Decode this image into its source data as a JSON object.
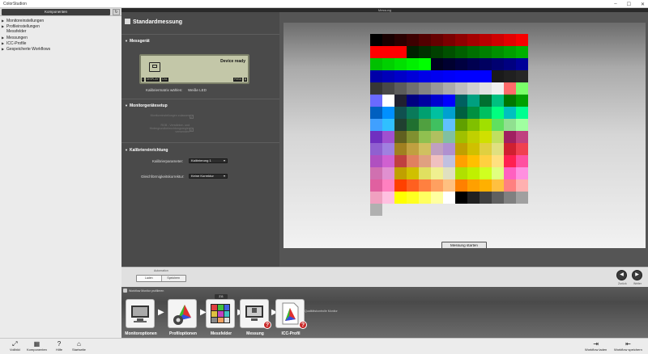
{
  "window": {
    "app_title": "ColorStudion",
    "controls": [
      "–",
      "☐",
      "✕"
    ]
  },
  "sidebar": {
    "tab_label": "Komponenten",
    "refresh_icon": "↻",
    "items": [
      {
        "label": "Monitoreinstellungen",
        "arrow": true
      },
      {
        "label": "Profileinstellungen",
        "arrow": true
      },
      {
        "label": "Messfelder",
        "arrow": false
      },
      {
        "label": "Messungen",
        "arrow": true
      },
      {
        "label": "ICC-Profile",
        "arrow": true
      },
      {
        "label": "Gespeicherte Workflows",
        "arrow": true
      }
    ]
  },
  "panel": {
    "window_title": "Messung",
    "title": "Standardmessung",
    "sections": {
      "device": "Messgerät",
      "monitor": "Monitorgerätesetup",
      "calibration": "Kalibriereinrichtung"
    },
    "lcd": {
      "status": "Device ready",
      "buttons": [
        "i",
        "DISPLAY",
        "CAL",
        "",
        "RIGA",
        "▮"
      ]
    },
    "matrix_label": "Kalibriermatrix wählen:",
    "matrix_value": "Weiße LED",
    "monitor_opts": [
      {
        "label": "Monitoreinstellungen zulassen",
        "checked": "✓"
      },
      {
        "label": "RGB - Verstärker- und Hintergrundbeleuchtungsregler verwenden",
        "checked": "✓"
      }
    ],
    "cal_param_label": "Kalibrierparameter:",
    "cal_param_value": "Kalibrierung 1",
    "uniformity_label": "Gleichförmigkeitskorrektur:",
    "uniformity_value": "Keine Korrektur"
  },
  "measure": {
    "start_label": "Messung starten",
    "patches": [
      [
        "#000000",
        "#180000",
        "#2a0000",
        "#3d0000",
        "#520000",
        "#660000",
        "#7b0000",
        "#900000",
        "#a50000",
        "#ba0000",
        "#cf0000",
        "#e40000",
        "#f80000"
      ],
      [
        "#ff0000",
        "#ff0000",
        "#ff0000",
        "#002000",
        "#003000",
        "#004000",
        "#005000",
        "#006000",
        "#007000",
        "#008000",
        "#009000",
        "#00a000",
        "#00b000"
      ],
      [
        "#00c000",
        "#00d000",
        "#00e000",
        "#00f000",
        "#00ff00",
        "#000020",
        "#000030",
        "#000040",
        "#000050",
        "#000060",
        "#000070",
        "#000080",
        "#000098"
      ],
      [
        "#0000a8",
        "#0000b8",
        "#0000c8",
        "#0000d8",
        "#0000e8",
        "#0000f0",
        "#0000f8",
        "#0000ff",
        "#0000ff",
        "#0000ff",
        "#1a1a1a",
        "#202020",
        "#262626"
      ],
      [
        "#363636",
        "#484848",
        "#5c5c5c",
        "#707070",
        "#848484",
        "#989898",
        "#ababab",
        "#bebebe",
        "#d0d0d0",
        "#e2e2e2",
        "#f0f0f0",
        "#ff6a6a",
        "#7aff6a"
      ],
      [
        "#6a6aff",
        "#ffffff",
        "#202030",
        "#000080",
        "#0000a0",
        "#0000d0",
        "#0000ff",
        "#006060",
        "#00a080",
        "#007030",
        "#00c080",
        "#007700",
        "#00a000"
      ],
      [
        "#0060c0",
        "#0090ff",
        "#105050",
        "#0a7a5a",
        "#00a070",
        "#00c0a0",
        "#00a0d0",
        "#006040",
        "#009040",
        "#00c060",
        "#00ff80",
        "#00c0c0",
        "#00ff90"
      ],
      [
        "#40a0ff",
        "#30c0ff",
        "#204030",
        "#207030",
        "#50a040",
        "#40c060",
        "#60c0ff",
        "#60a000",
        "#80c000",
        "#a0e000",
        "#60e060",
        "#90e090",
        "#a0ffa0"
      ],
      [
        "#7030c0",
        "#a050d0",
        "#606020",
        "#809030",
        "#90c050",
        "#b0c060",
        "#80c0a0",
        "#a0c000",
        "#c0d000",
        "#d0e000",
        "#c0e060",
        "#a02060",
        "#c04080"
      ],
      [
        "#9060d0",
        "#a080e0",
        "#a08020",
        "#c0a040",
        "#d0c060",
        "#c0a0c0",
        "#b090d0",
        "#c0a000",
        "#d0c000",
        "#e0d040",
        "#e0e080",
        "#d02030",
        "#f04050"
      ],
      [
        "#b050c0",
        "#d060d0",
        "#c04040",
        "#e08060",
        "#e0a080",
        "#f0c0c0",
        "#c0c0e0",
        "#ffa000",
        "#ffc000",
        "#ffd040",
        "#ffe080",
        "#ff2050",
        "#ff50a0"
      ],
      [
        "#d070b0",
        "#e090d0",
        "#c0a000",
        "#d0c000",
        "#e0e060",
        "#f0f090",
        "#e0e0c0",
        "#b0e000",
        "#c0f000",
        "#d0ff20",
        "#e0ff80",
        "#ff60c0",
        "#ff90e0"
      ],
      [
        "#e060a0",
        "#ff80c0",
        "#ff4000",
        "#ff6020",
        "#ff8040",
        "#ffa060",
        "#ffc080",
        "#ff8000",
        "#ffa000",
        "#ffb000",
        "#ffc040",
        "#ff8080",
        "#ffb0b0"
      ],
      [
        "#f0a0c0",
        "#ffc0e0",
        "#ffff00",
        "#ffff20",
        "#ffff60",
        "#ffffa0",
        "#ffffff",
        "#000000",
        "#202020",
        "#404040",
        "#606060",
        "#808080",
        "#a0a0a0"
      ],
      [
        "#b0b0b0"
      ]
    ]
  },
  "navbar": {
    "caption": "Automation",
    "seg": [
      "Laden",
      "Speichern"
    ],
    "back_label": "Zurück",
    "next_label": "Weiter",
    "back_icon": "◀",
    "next_icon": "▶"
  },
  "workflow": {
    "header": "Workflow Monitor profilieren",
    "qual_label": "Qualitätskontrolle Monitor",
    "steps": [
      {
        "label": "Monitoroptionen",
        "badge": ""
      },
      {
        "label": "Profiloptionen",
        "badge": ""
      },
      {
        "label": "Messfelder",
        "badge": "",
        "tag": "211"
      },
      {
        "label": "Messung",
        "badge": "?"
      },
      {
        "label": "ICC-Profil",
        "badge": "?"
      }
    ]
  },
  "bottom": {
    "left": [
      {
        "label": "Vollbild",
        "icon": "⤢"
      },
      {
        "label": "Komponenten",
        "icon": "▦"
      },
      {
        "label": "Hilfe",
        "icon": "?"
      },
      {
        "label": "Startseite",
        "icon": "⌂"
      }
    ],
    "right": [
      {
        "label": "Workflow laden",
        "icon": "⇥"
      },
      {
        "label": "Workflow speichern",
        "icon": "⇤"
      }
    ]
  }
}
